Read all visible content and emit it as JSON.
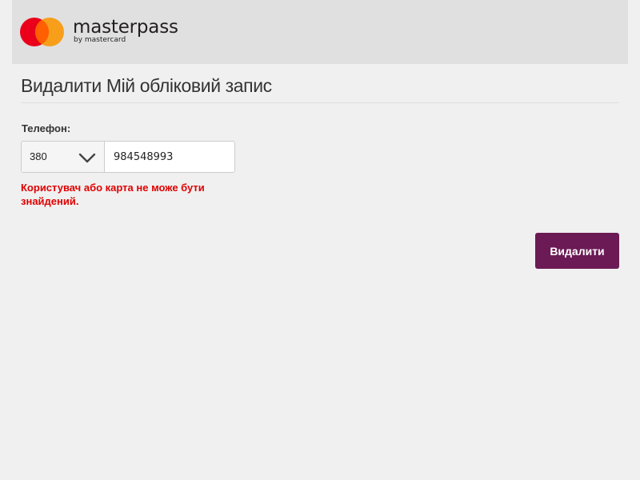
{
  "brand": {
    "wordmark": "masterpass",
    "byline": "by mastercard",
    "logo_icon": "mastercard-circles-icon",
    "colors": {
      "red": "#eb001b",
      "orange": "#f79e1b",
      "overlap": "#ff5f00"
    }
  },
  "page": {
    "title": "Видалити Мій обліковий запис"
  },
  "form": {
    "phone_label": "Телефон:",
    "country_code": "380",
    "dropdown_icon": "chevron-down-icon",
    "phone_number": "984548993",
    "error_message": "Користувач або карта не може бути знайдений."
  },
  "actions": {
    "delete_label": "Видалити"
  },
  "colors": {
    "accent": "#6b1a55",
    "error": "#e00000",
    "background": "#f0f0f0",
    "header_background": "#e0e0e0"
  }
}
